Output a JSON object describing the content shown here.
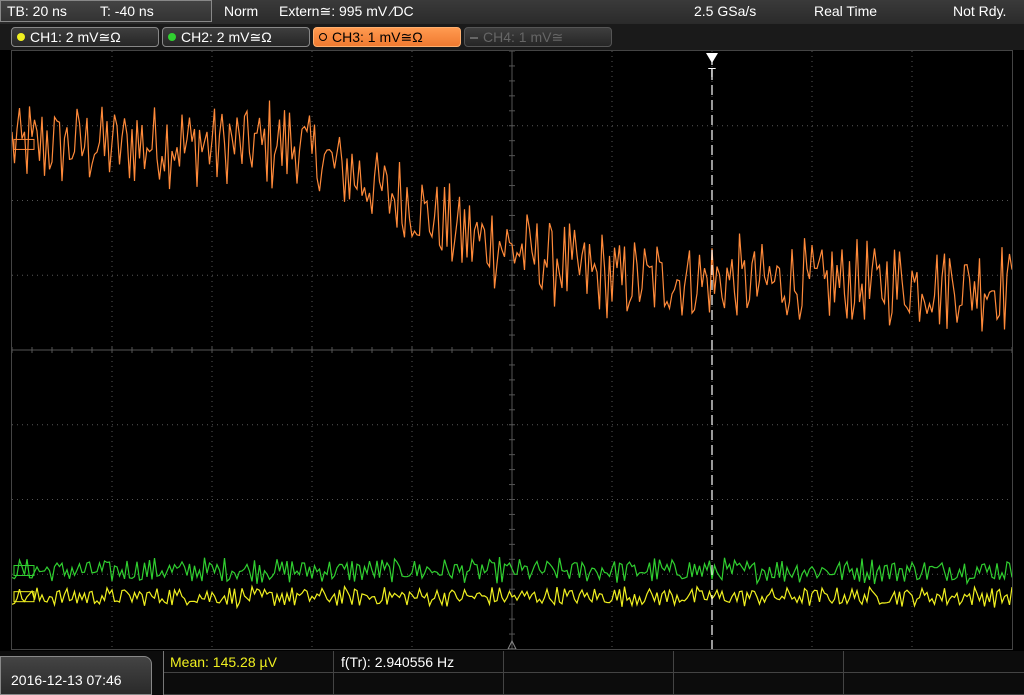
{
  "status": {
    "timebase": "TB: 20 ns",
    "trigger_time": "T: -40 ns",
    "mode": "Norm",
    "trigger_source": "Extern≅: 995 mV ⁄DC",
    "sample_rate": "2.5 GSa/s",
    "acq_mode": "Real Time",
    "state": "Not Rdy."
  },
  "channels": [
    {
      "label": "CH1: 2 mV≅Ω",
      "color": "#e8e830",
      "active": true
    },
    {
      "label": "CH2: 2 mV≅Ω",
      "color": "#30d040",
      "active": true
    },
    {
      "label": "CH3: 1 mV≅Ω",
      "color": "#ff8030",
      "active": true,
      "selected": true
    },
    {
      "label": "CH4: 1 mV≅",
      "color": "#777777",
      "active": false
    }
  ],
  "measurements": {
    "mean": "Mean: 145.28 µV",
    "freq": "f(Tr): 2.940556 Hz"
  },
  "datetime": "2016-12-13 07:46",
  "trigger_marker": "T",
  "colors": {
    "grid": "#555555",
    "ch1": "#f0f020",
    "ch2": "#30d030",
    "ch3": "#ff8a3a"
  },
  "chart_data": {
    "type": "line",
    "xlim": [
      -100,
      100
    ],
    "x_unit": "ns",
    "series": [
      {
        "channel": "CH3",
        "levels": [
          {
            "x": -100,
            "y": 2.75
          },
          {
            "x": -43,
            "y": 2.75
          },
          {
            "x": -10,
            "y": 1.55
          },
          {
            "x": 20,
            "y": 0.95
          },
          {
            "x": 100,
            "y": 0.85
          }
        ],
        "noise": 0.9
      },
      {
        "channel": "CH2",
        "levels": [
          {
            "x": -100,
            "y": -2.95
          },
          {
            "x": 100,
            "y": -2.95
          }
        ],
        "noise": 0.25
      },
      {
        "channel": "CH1",
        "levels": [
          {
            "x": -100,
            "y": -3.3
          },
          {
            "x": 100,
            "y": -3.3
          }
        ],
        "noise": 0.2
      }
    ],
    "trigger_x": 40
  }
}
